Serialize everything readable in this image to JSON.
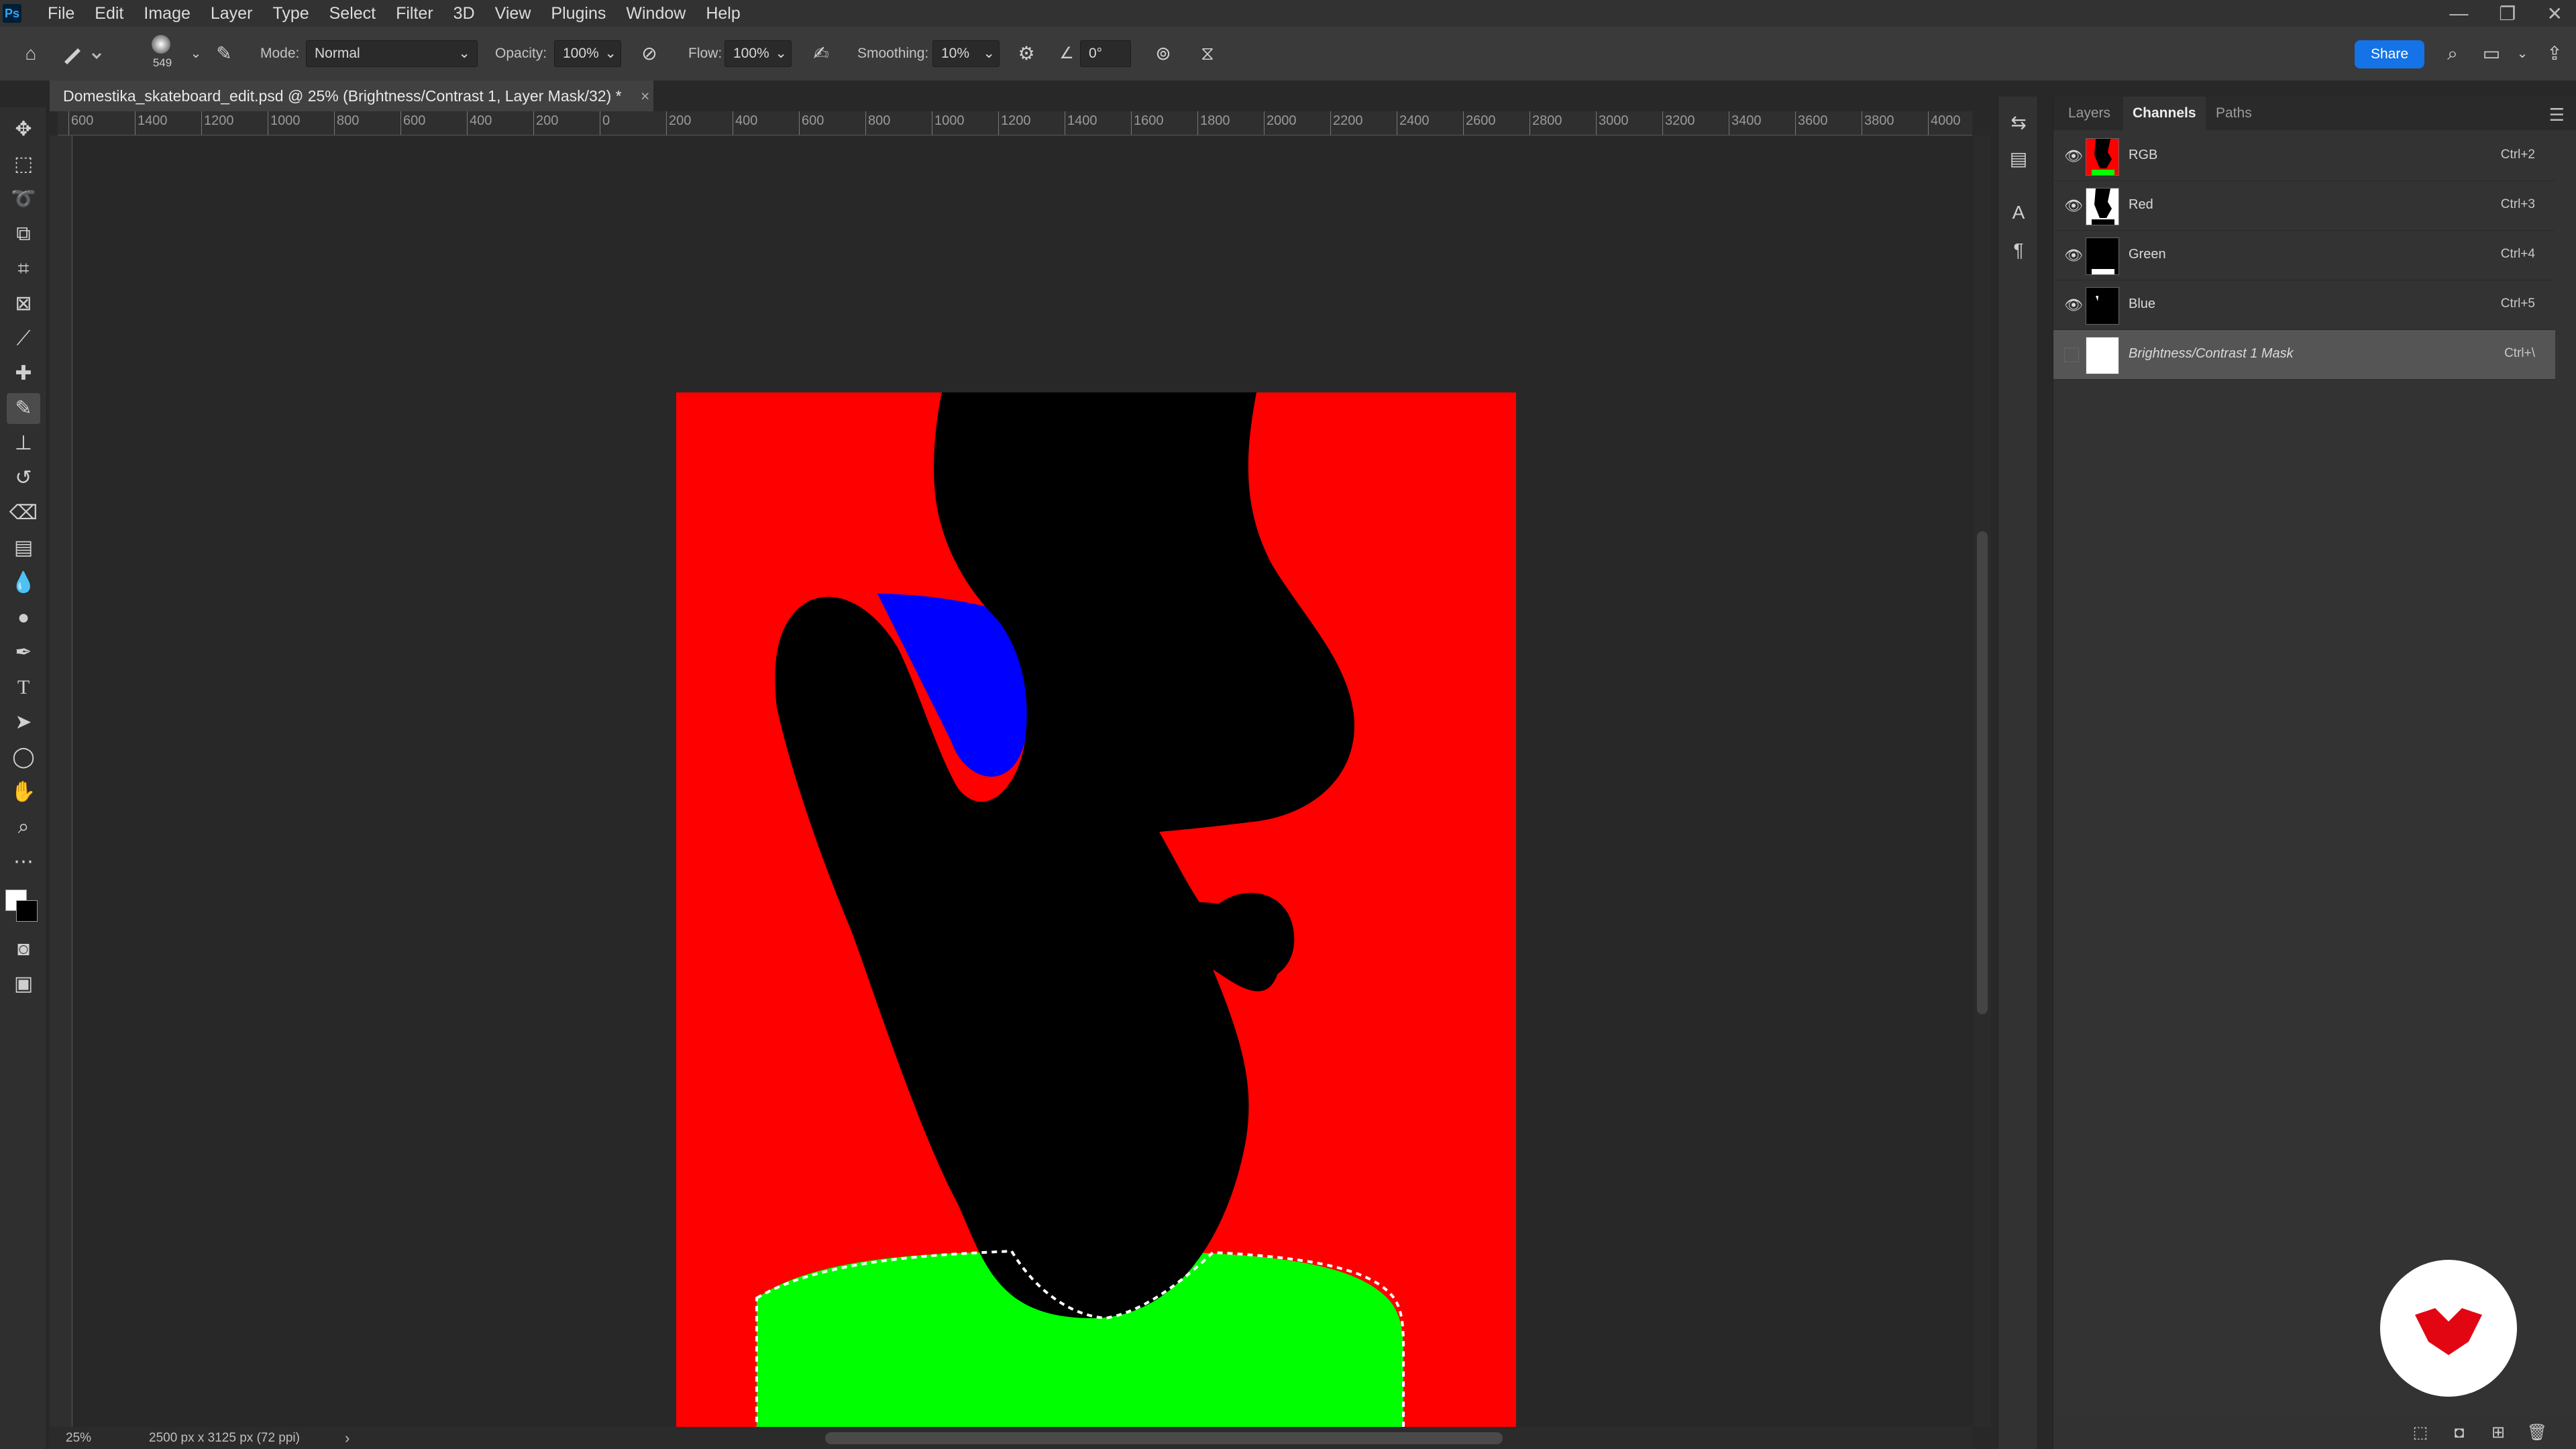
{
  "app": {
    "logo": "Ps"
  },
  "menu": [
    "File",
    "Edit",
    "Image",
    "Layer",
    "Type",
    "Select",
    "Filter",
    "3D",
    "View",
    "Plugins",
    "Window",
    "Help"
  ],
  "window_controls": {
    "minimize": "—",
    "restore": "❐",
    "close": "✕"
  },
  "options": {
    "brush_size": "549",
    "mode_label": "Mode:",
    "mode_value": "Normal",
    "opacity_label": "Opacity:",
    "opacity_value": "100%",
    "flow_label": "Flow:",
    "flow_value": "100%",
    "smoothing_label": "Smoothing:",
    "smoothing_value": "10%",
    "angle_value": "0°",
    "share_label": "Share"
  },
  "document": {
    "tab_title": "Domestika_skateboard_edit.psd @ 25% (Brightness/Contrast 1, Layer Mask/32) *",
    "close": "×"
  },
  "ruler": {
    "top_labels": [
      "600",
      "1400",
      "1200",
      "1000",
      "800",
      "600",
      "400",
      "200",
      "0",
      "200",
      "400",
      "600",
      "800",
      "1000",
      "1200",
      "1400",
      "1600",
      "1800",
      "2000",
      "2200",
      "2400",
      "2600",
      "2800",
      "3000",
      "3200",
      "3400",
      "3600",
      "3800",
      "4000"
    ]
  },
  "status": {
    "zoom": "25%",
    "doc_info": "2500 px x 3125 px (72 ppi)",
    "arrow": "›"
  },
  "panel": {
    "tabs": [
      "Layers",
      "Channels",
      "Paths"
    ],
    "active_tab": "Channels",
    "channels": [
      {
        "name": "RGB",
        "shortcut": "Ctrl+2",
        "visible": true
      },
      {
        "name": "Red",
        "shortcut": "Ctrl+3",
        "visible": true
      },
      {
        "name": "Green",
        "shortcut": "Ctrl+4",
        "visible": true
      },
      {
        "name": "Blue",
        "shortcut": "Ctrl+5",
        "visible": true
      },
      {
        "name": "Brightness/Contrast 1 Mask",
        "shortcut": "Ctrl+\\",
        "visible": false
      }
    ]
  },
  "colors": {
    "artboard_red": "#ff0000",
    "figure_black": "#000000",
    "accent_blue": "#0000ff",
    "accent_green": "#00ff00",
    "share_blue": "#1473e6",
    "brand_red": "#e20613"
  }
}
